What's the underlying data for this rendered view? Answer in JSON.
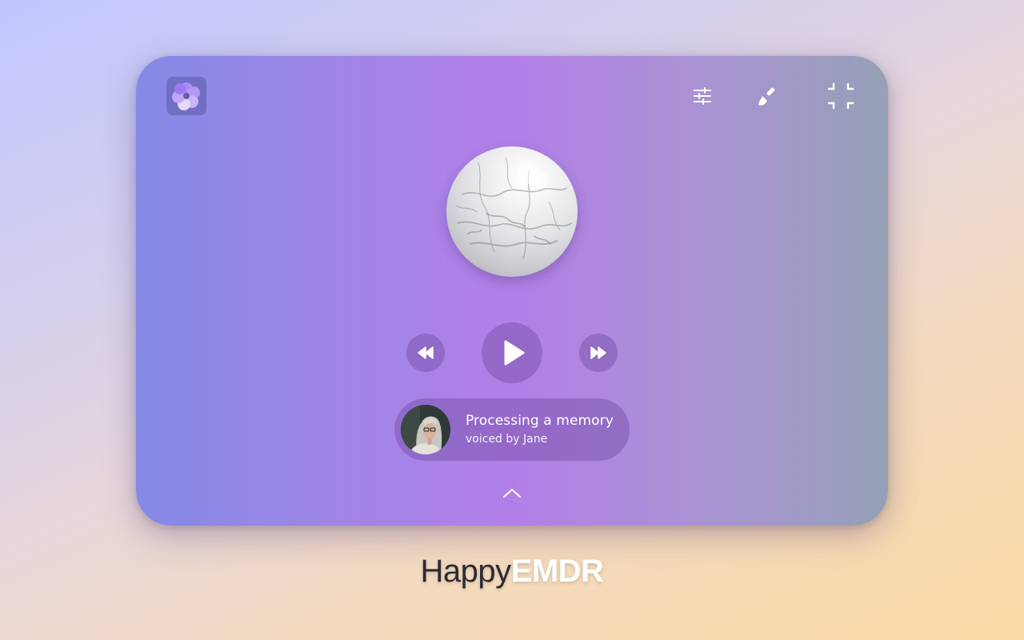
{
  "app": {
    "name": "HappyEMDR"
  },
  "toolbar": {
    "logo_icon": "flower-icon",
    "settings_icon": "sliders-icon",
    "theme_icon": "paintbrush-icon",
    "fullscreen_icon": "exit-fullscreen-icon"
  },
  "visual": {
    "orb": "marble-sphere"
  },
  "player": {
    "rewind_icon": "rewind-icon",
    "play_icon": "play-icon",
    "forward_icon": "fast-forward-icon"
  },
  "now_playing": {
    "title": "Processing a memory",
    "subtitle": "voiced by Jane",
    "avatar": "narrator-avatar",
    "expand_icon": "chevron-up-icon"
  },
  "footer": {
    "brand_light": "Happy",
    "brand_bold": "EMDR"
  },
  "colors": {
    "card_start": "#8489e6",
    "card_mid": "#b27fe8",
    "card_end": "#95a0b6",
    "control_bg": "#7852aa"
  }
}
